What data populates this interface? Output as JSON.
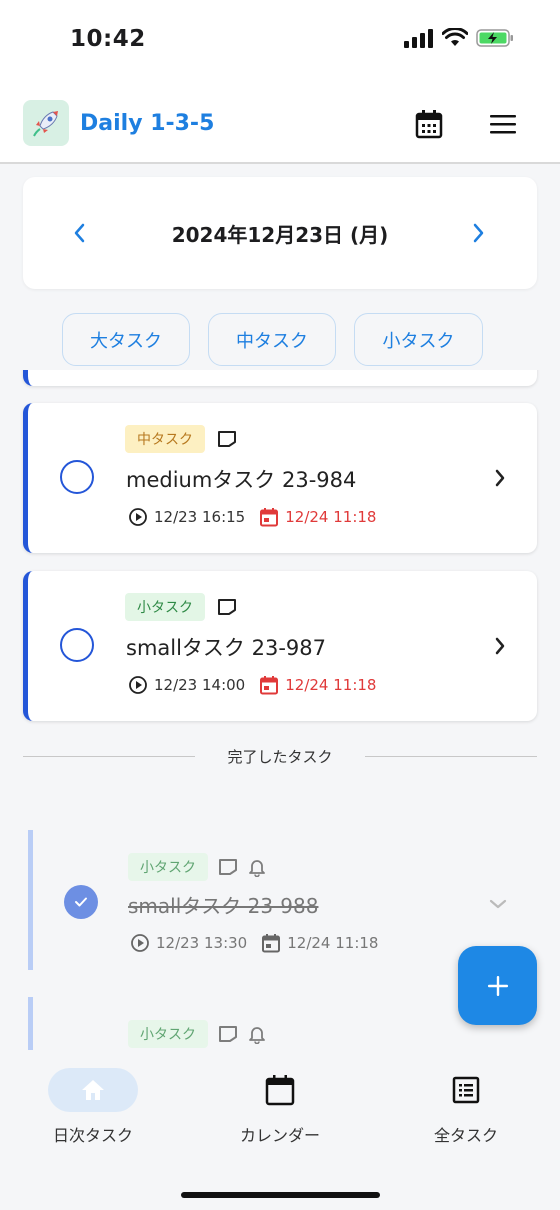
{
  "status_bar": {
    "time": "10:42"
  },
  "header": {
    "app_title": "Daily 1-3-5"
  },
  "date_nav": {
    "date": "2024年12月23日 (月)"
  },
  "filters": [
    {
      "label": "大タスク"
    },
    {
      "label": "中タスク"
    },
    {
      "label": "小タスク"
    }
  ],
  "tasks": [
    {
      "tag": "中タスク",
      "title": "mediumタスク 23-984",
      "start": "12/23 16:15",
      "due": "12/24 11:18"
    },
    {
      "tag": "小タスク",
      "title": "smallタスク 23-987",
      "start": "12/23 14:00",
      "due": "12/24 11:18"
    }
  ],
  "completed_section": {
    "label": "完了したタスク"
  },
  "completed_tasks": [
    {
      "tag": "小タスク",
      "title": "smallタスク 23-988",
      "start": "12/23 13:30",
      "due": "12/24 11:18"
    },
    {
      "tag": "小タスク"
    }
  ],
  "bottom_nav": [
    {
      "label": "日次タスク"
    },
    {
      "label": "カレンダー"
    },
    {
      "label": "全タスク"
    }
  ],
  "colors": {
    "accent": "#1e88e5",
    "task_border": "#2456d8",
    "overdue": "#e03a3a"
  }
}
